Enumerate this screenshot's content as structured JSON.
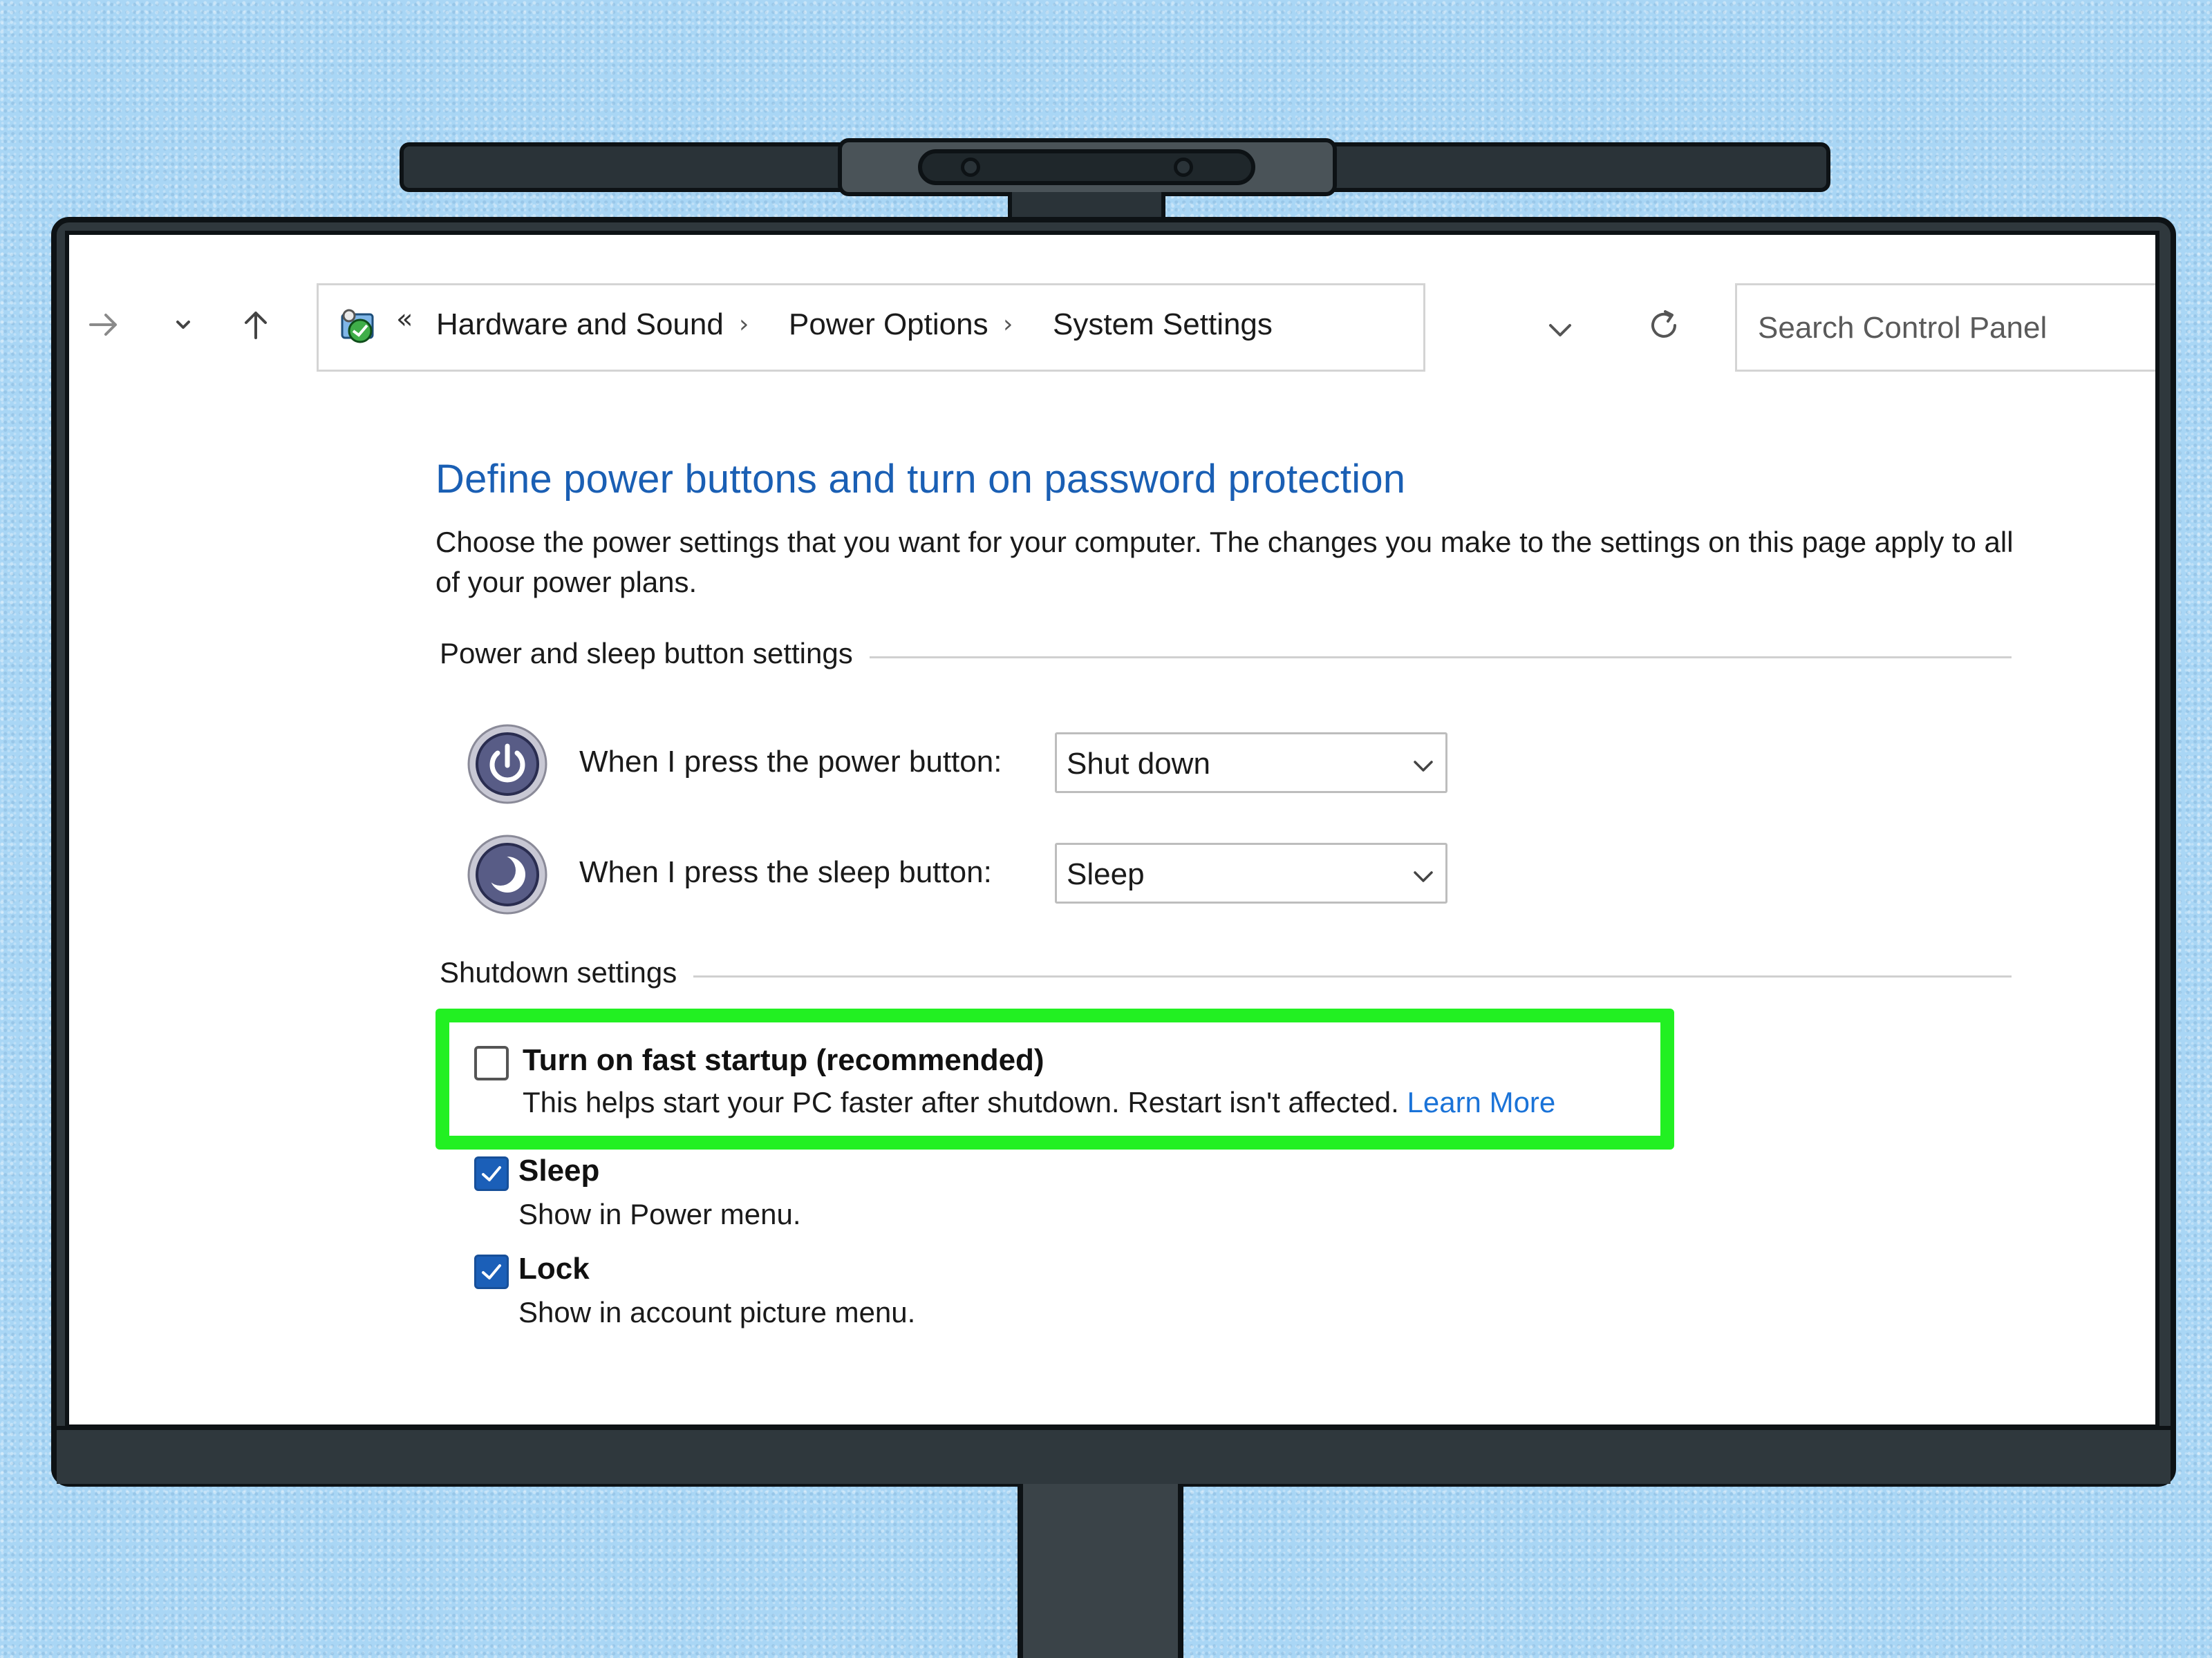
{
  "nav": {
    "forward_icon": "arrow-right-icon",
    "recent_icon": "chevron-down-icon",
    "up_icon": "arrow-up-icon"
  },
  "address_bar": {
    "overflow": "«",
    "crumbs": [
      "Hardware and Sound",
      "Power Options",
      "System Settings"
    ],
    "separator": "›"
  },
  "search": {
    "placeholder": "Search Control Panel"
  },
  "page": {
    "title": "Define power buttons and turn on password protection",
    "description": "Choose the power settings that you want for your computer. The changes you make to the settings on this page apply to all of your power plans."
  },
  "power_section": {
    "header": "Power and sleep button settings",
    "power_button": {
      "label": "When I press the power button:",
      "value": "Shut down"
    },
    "sleep_button": {
      "label": "When I press the sleep button:",
      "value": "Sleep"
    }
  },
  "shutdown_section": {
    "header": "Shutdown settings",
    "options": [
      {
        "title": "Turn on fast startup (recommended)",
        "desc": "This helps start your PC faster after shutdown. Restart isn't affected.",
        "link": "Learn More",
        "checked": false
      },
      {
        "title": "Sleep",
        "desc": "Show in Power menu.",
        "checked": true
      },
      {
        "title": "Lock",
        "desc": "Show in account picture menu.",
        "checked": true
      }
    ]
  },
  "colors": {
    "accent": "#1a5fb4",
    "link": "#1a73d8",
    "highlight": "#22f022",
    "checkbox_checked": "#1b5fb8",
    "background": "#a9d6f5"
  }
}
